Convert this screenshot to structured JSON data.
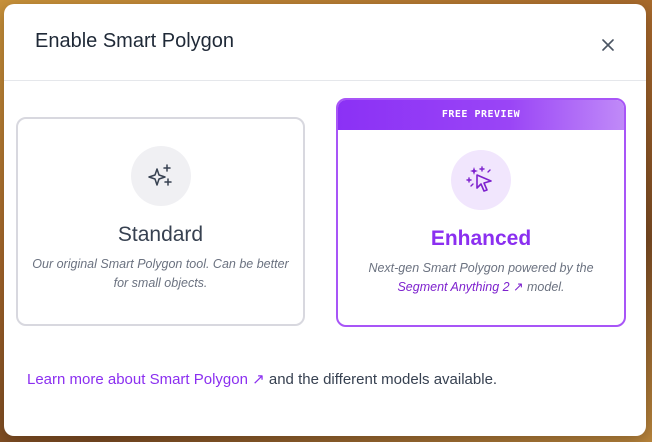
{
  "dialog": {
    "title": "Enable Smart Polygon",
    "close_icon": "close-icon"
  },
  "options": {
    "standard": {
      "icon": "sparkles-icon",
      "title": "Standard",
      "description": "Our original Smart Polygon tool. Can be better for small objects."
    },
    "enhanced": {
      "badge": "FREE PREVIEW",
      "icon": "magic-cursor-icon",
      "title": "Enhanced",
      "description_before": "Next-gen Smart Polygon powered by the",
      "link_text": "Segment Anything 2 ↗",
      "description_after": " model."
    }
  },
  "footer": {
    "link_text": "Learn more about Smart Polygon ↗",
    "text": " and the different models available."
  },
  "colors": {
    "accent": "#8b2ff0",
    "selected_border": "#a855f7"
  }
}
